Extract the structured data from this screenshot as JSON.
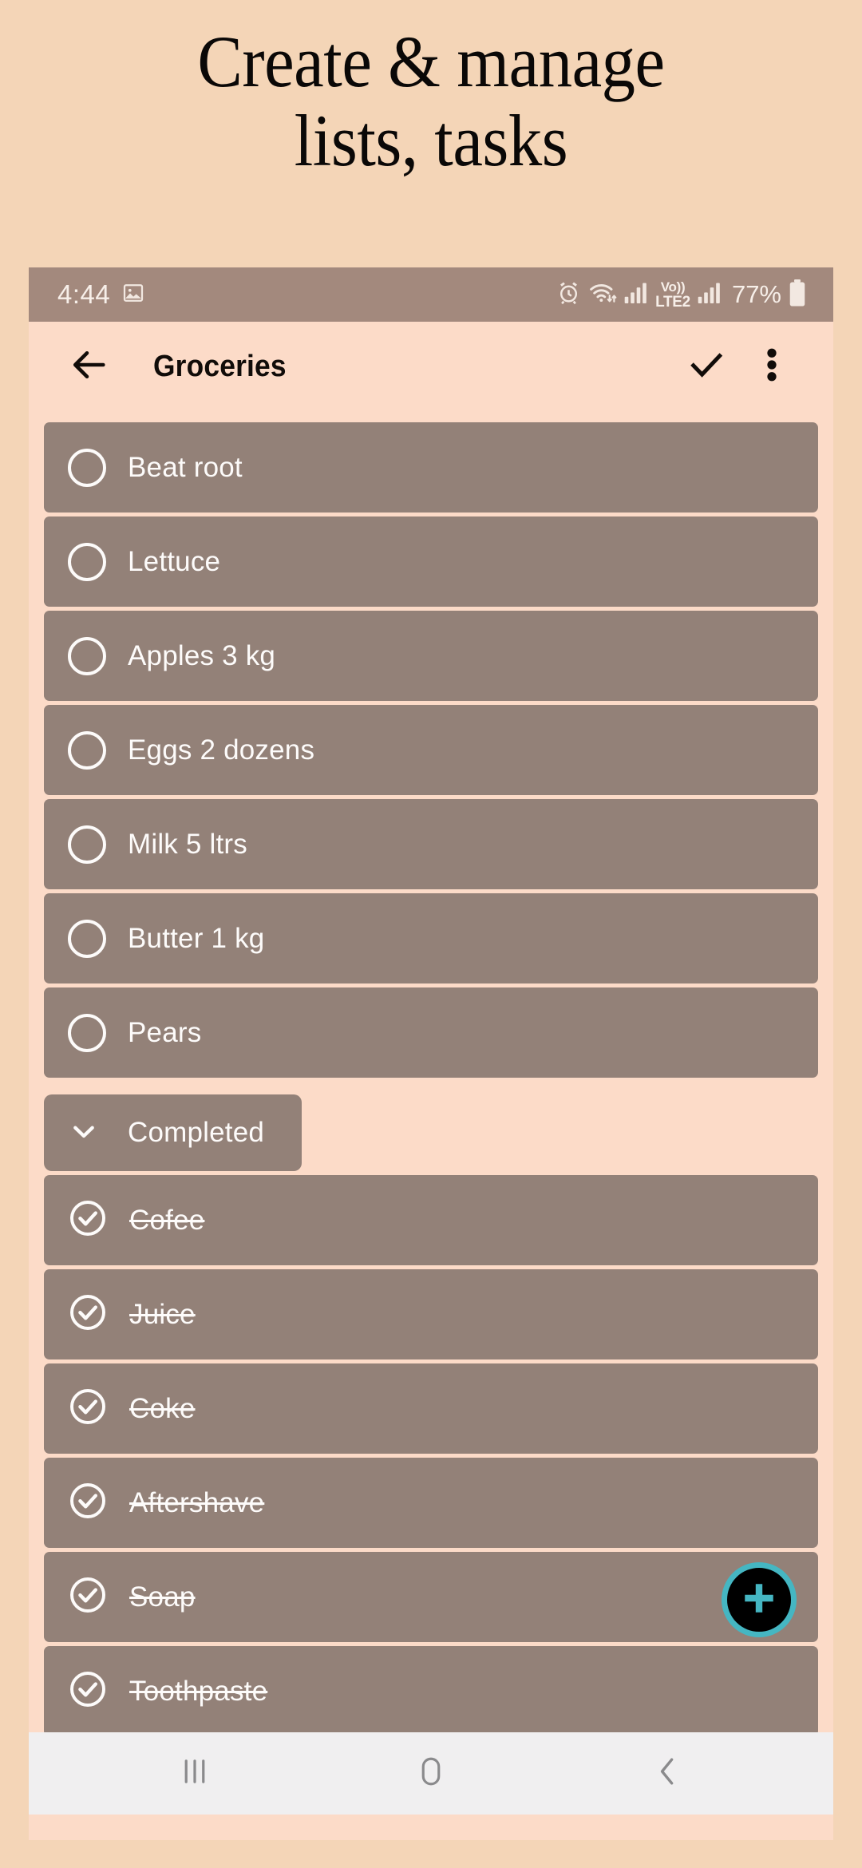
{
  "promo": {
    "line1": "Create & manage",
    "line2": "lists, tasks"
  },
  "status_bar": {
    "clock": "4:44",
    "image_icon": "image-icon",
    "alarm_icon": "alarm-icon",
    "wifi_icon": "wifi-icon",
    "signal_icon_1": "signal-bars-icon",
    "volte_top": "Vo))",
    "volte_bottom": "LTE2",
    "signal_icon_2": "signal-bars-icon",
    "battery_percent": "77%",
    "battery_icon": "battery-icon",
    "background_color": "#a3897d"
  },
  "app_bar": {
    "back_icon": "arrow-back-icon",
    "title": "Groceries",
    "confirm_icon": "check-icon",
    "overflow_icon": "more-vertical-icon",
    "background_color": "#fcdbc8"
  },
  "theme": {
    "page_background": "#f4d5b7",
    "screen_background": "#fcdbc8",
    "task_row_background": "#938178",
    "task_text": "#fdfbfa",
    "fab_ring": "#45b6c2",
    "fab_fill": "#000000",
    "nav_bar_background": "#f0eff0"
  },
  "tasks": {
    "pending": [
      {
        "label": "Beat root",
        "checked": false
      },
      {
        "label": "Lettuce",
        "checked": false
      },
      {
        "label": "Apples 3 kg",
        "checked": false
      },
      {
        "label": "Eggs 2 dozens",
        "checked": false
      },
      {
        "label": "Milk 5 ltrs",
        "checked": false
      },
      {
        "label": "Butter 1 kg",
        "checked": false
      },
      {
        "label": "Pears",
        "checked": false
      }
    ],
    "completed_section": {
      "label": "Completed",
      "chevron_icon": "chevron-down-icon",
      "expanded": true
    },
    "completed": [
      {
        "label": "Cofee",
        "checked": true
      },
      {
        "label": "Juice",
        "checked": true
      },
      {
        "label": "Coke",
        "checked": true
      },
      {
        "label": "Aftershave",
        "checked": true
      },
      {
        "label": "Soap",
        "checked": true
      },
      {
        "label": "Toothpaste",
        "checked": true
      },
      {
        "label": "",
        "checked": true
      }
    ]
  },
  "fab": {
    "icon": "plus-icon",
    "label": "Add task"
  },
  "nav_bar": {
    "recents_icon": "recents-icon",
    "home_icon": "home-icon",
    "back_icon": "nav-back-icon"
  }
}
